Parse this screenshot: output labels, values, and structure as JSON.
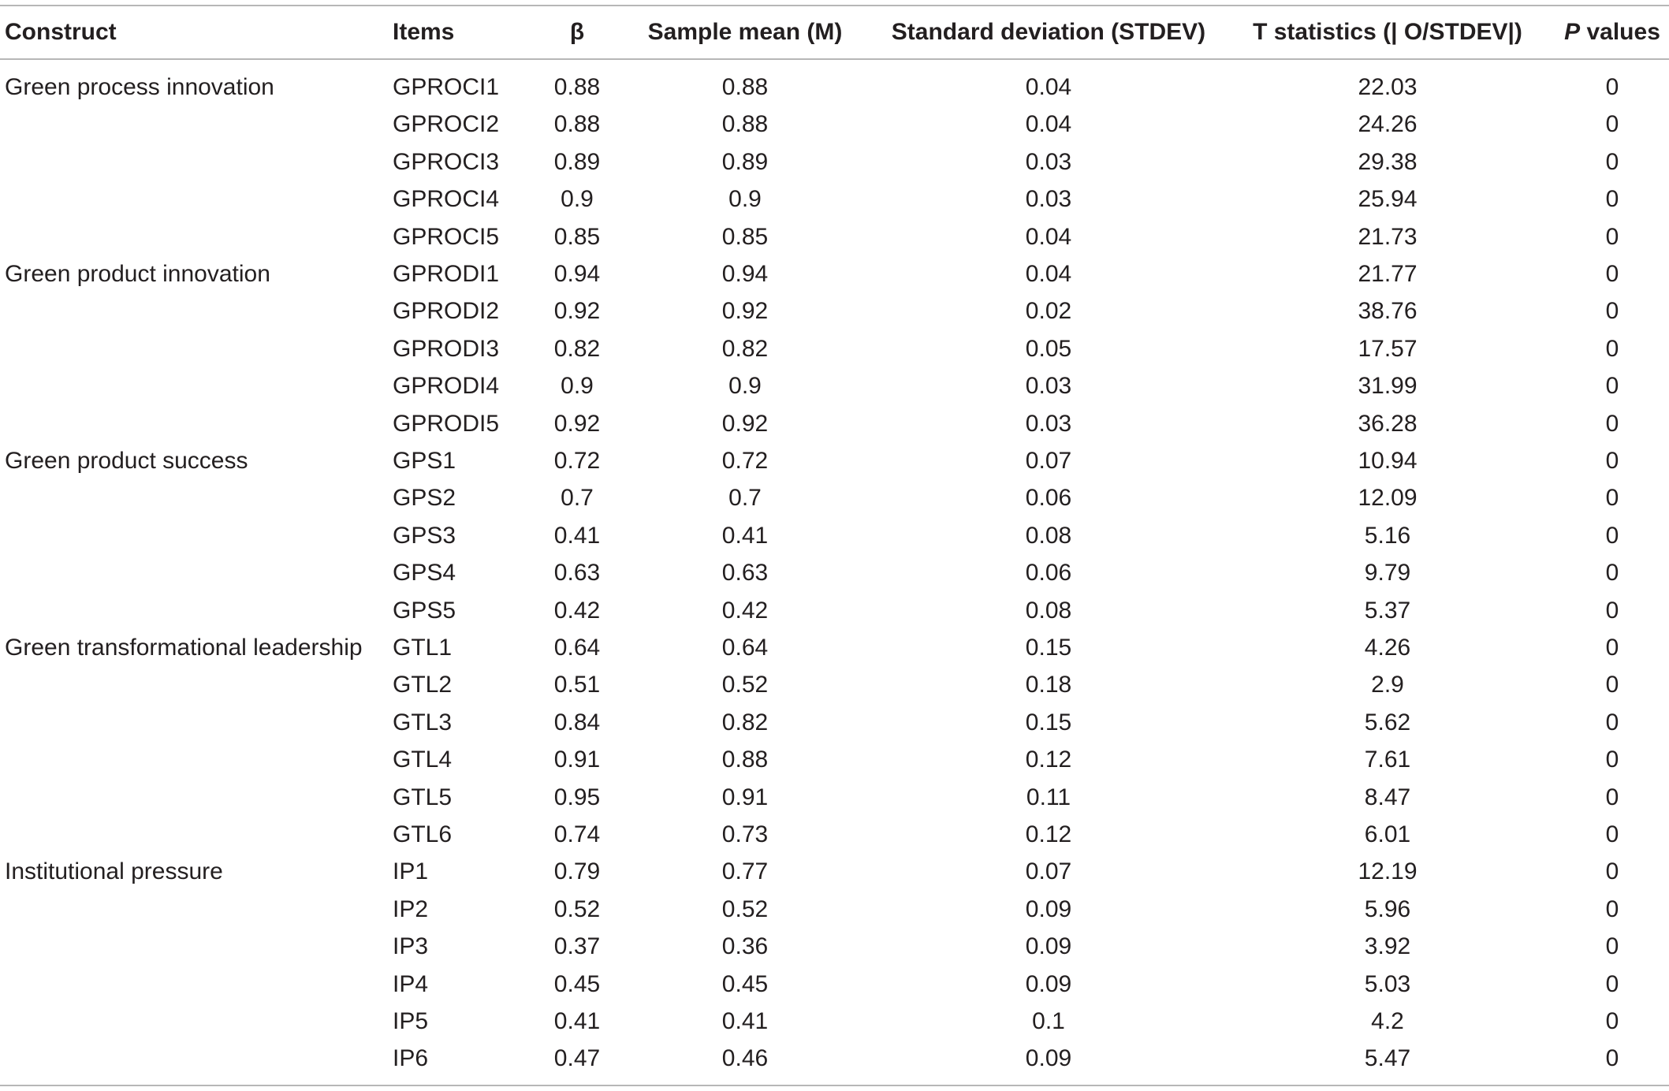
{
  "headers": {
    "construct": "Construct",
    "items": "Items",
    "beta": "β",
    "mean": "Sample mean (M)",
    "sd": "Standard deviation (STDEV)",
    "t": "T statistics (| O/STDEV|)",
    "p_italic": "P",
    "p_rest": " values"
  },
  "rows": [
    {
      "construct": "Green process innovation",
      "item": "GPROCI1",
      "beta": "0.88",
      "mean": "0.88",
      "sd": "0.04",
      "t": "22.03",
      "p": "0"
    },
    {
      "construct": "",
      "item": "GPROCI2",
      "beta": "0.88",
      "mean": "0.88",
      "sd": "0.04",
      "t": "24.26",
      "p": "0"
    },
    {
      "construct": "",
      "item": "GPROCI3",
      "beta": "0.89",
      "mean": "0.89",
      "sd": "0.03",
      "t": "29.38",
      "p": "0"
    },
    {
      "construct": "",
      "item": "GPROCI4",
      "beta": "0.9",
      "mean": "0.9",
      "sd": "0.03",
      "t": "25.94",
      "p": "0"
    },
    {
      "construct": "",
      "item": "GPROCI5",
      "beta": "0.85",
      "mean": "0.85",
      "sd": "0.04",
      "t": "21.73",
      "p": "0"
    },
    {
      "construct": "Green product innovation",
      "item": "GPRODI1",
      "beta": "0.94",
      "mean": "0.94",
      "sd": "0.04",
      "t": "21.77",
      "p": "0"
    },
    {
      "construct": "",
      "item": "GPRODI2",
      "beta": "0.92",
      "mean": "0.92",
      "sd": "0.02",
      "t": "38.76",
      "p": "0"
    },
    {
      "construct": "",
      "item": "GPRODI3",
      "beta": "0.82",
      "mean": "0.82",
      "sd": "0.05",
      "t": "17.57",
      "p": "0"
    },
    {
      "construct": "",
      "item": "GPRODI4",
      "beta": "0.9",
      "mean": "0.9",
      "sd": "0.03",
      "t": "31.99",
      "p": "0"
    },
    {
      "construct": "",
      "item": "GPRODI5",
      "beta": "0.92",
      "mean": "0.92",
      "sd": "0.03",
      "t": "36.28",
      "p": "0"
    },
    {
      "construct": "Green product success",
      "item": "GPS1",
      "beta": "0.72",
      "mean": "0.72",
      "sd": "0.07",
      "t": "10.94",
      "p": "0"
    },
    {
      "construct": "",
      "item": "GPS2",
      "beta": "0.7",
      "mean": "0.7",
      "sd": "0.06",
      "t": "12.09",
      "p": "0"
    },
    {
      "construct": "",
      "item": "GPS3",
      "beta": "0.41",
      "mean": "0.41",
      "sd": "0.08",
      "t": "5.16",
      "p": "0"
    },
    {
      "construct": "",
      "item": "GPS4",
      "beta": "0.63",
      "mean": "0.63",
      "sd": "0.06",
      "t": "9.79",
      "p": "0"
    },
    {
      "construct": "",
      "item": "GPS5",
      "beta": "0.42",
      "mean": "0.42",
      "sd": "0.08",
      "t": "5.37",
      "p": "0"
    },
    {
      "construct": "Green transformational leadership",
      "item": "GTL1",
      "beta": "0.64",
      "mean": "0.64",
      "sd": "0.15",
      "t": "4.26",
      "p": "0"
    },
    {
      "construct": "",
      "item": "GTL2",
      "beta": "0.51",
      "mean": "0.52",
      "sd": "0.18",
      "t": "2.9",
      "p": "0"
    },
    {
      "construct": "",
      "item": "GTL3",
      "beta": "0.84",
      "mean": "0.82",
      "sd": "0.15",
      "t": "5.62",
      "p": "0"
    },
    {
      "construct": "",
      "item": "GTL4",
      "beta": "0.91",
      "mean": "0.88",
      "sd": "0.12",
      "t": "7.61",
      "p": "0"
    },
    {
      "construct": "",
      "item": "GTL5",
      "beta": "0.95",
      "mean": "0.91",
      "sd": "0.11",
      "t": "8.47",
      "p": "0"
    },
    {
      "construct": "",
      "item": "GTL6",
      "beta": "0.74",
      "mean": "0.73",
      "sd": "0.12",
      "t": "6.01",
      "p": "0"
    },
    {
      "construct": "Institutional pressure",
      "item": "IP1",
      "beta": "0.79",
      "mean": "0.77",
      "sd": "0.07",
      "t": "12.19",
      "p": "0"
    },
    {
      "construct": "",
      "item": "IP2",
      "beta": "0.52",
      "mean": "0.52",
      "sd": "0.09",
      "t": "5.96",
      "p": "0"
    },
    {
      "construct": "",
      "item": "IP3",
      "beta": "0.37",
      "mean": "0.36",
      "sd": "0.09",
      "t": "3.92",
      "p": "0"
    },
    {
      "construct": "",
      "item": "IP4",
      "beta": "0.45",
      "mean": "0.45",
      "sd": "0.09",
      "t": "5.03",
      "p": "0"
    },
    {
      "construct": "",
      "item": "IP5",
      "beta": "0.41",
      "mean": "0.41",
      "sd": "0.1",
      "t": "4.2",
      "p": "0"
    },
    {
      "construct": "",
      "item": "IP6",
      "beta": "0.47",
      "mean": "0.46",
      "sd": "0.09",
      "t": "5.47",
      "p": "0"
    }
  ]
}
